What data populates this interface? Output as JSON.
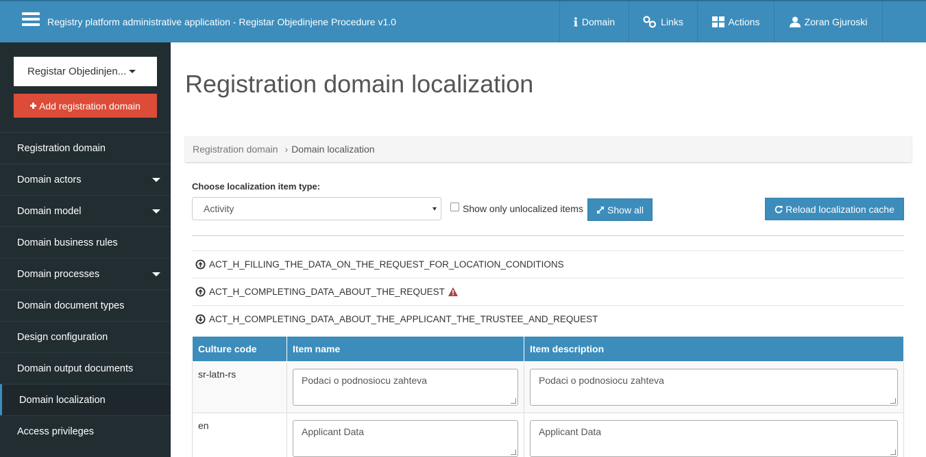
{
  "header": {
    "app_title": "Registry platform administrative application - Registar Objedinjene Procedure v1.0",
    "nav": [
      {
        "label": "Domain",
        "icon": "info-icon"
      },
      {
        "label": "Links",
        "icon": "link-icon"
      },
      {
        "label": "Actions",
        "icon": "grid-icon"
      },
      {
        "label": "Zoran Gjuroski",
        "icon": "user-icon"
      }
    ]
  },
  "sidebar": {
    "domain_select": "Registar Objedinjen...",
    "add_domain_label": "Add registration domain",
    "items": [
      {
        "label": "Registration domain",
        "has_submenu": false
      },
      {
        "label": "Domain actors",
        "has_submenu": true
      },
      {
        "label": "Domain model",
        "has_submenu": true
      },
      {
        "label": "Domain business rules",
        "has_submenu": false
      },
      {
        "label": "Domain processes",
        "has_submenu": true
      },
      {
        "label": "Domain document types",
        "has_submenu": false
      },
      {
        "label": "Design configuration",
        "has_submenu": false
      },
      {
        "label": "Domain output documents",
        "has_submenu": false
      },
      {
        "label": "Domain localization",
        "has_submenu": false,
        "active": true
      },
      {
        "label": "Access privileges",
        "has_submenu": false
      }
    ]
  },
  "main": {
    "page_title": "Registration domain localization",
    "breadcrumb": {
      "parent": "Registration domain",
      "current": "Domain localization"
    },
    "choose_label": "Choose localization item type:",
    "type_select_value": "Activity",
    "unlocalized_label": "Show only unlocalized items",
    "unlocalized_checked": false,
    "show_all_label": "Show all",
    "reload_label": "Reload localization cache",
    "activities": [
      {
        "code": "ACT_H_FILLING_THE_DATA_ON_THE_REQUEST_FOR_LOCATION_CONDITIONS",
        "expanded": false,
        "warning": false
      },
      {
        "code": "ACT_H_COMPLETING_DATA_ABOUT_THE_REQUEST",
        "expanded": false,
        "warning": true
      },
      {
        "code": "ACT_H_COMPLETING_DATA_ABOUT_THE_APPLICANT_THE_TRUSTEE_AND_REQUEST",
        "expanded": true,
        "warning": false
      }
    ],
    "table": {
      "headers": [
        "Culture code",
        "Item name",
        "Item description"
      ],
      "rows": [
        {
          "culture": "sr-latn-rs",
          "name": "Podaci o podnosiocu zahteva",
          "description": "Podaci o podnosiocu zahteva"
        },
        {
          "culture": "en",
          "name": "Applicant Data",
          "description": "Applicant Data"
        }
      ]
    }
  },
  "colors": {
    "primary": "#3c8dbc",
    "danger": "#dd4b39",
    "sidebar_bg": "#222d32"
  }
}
